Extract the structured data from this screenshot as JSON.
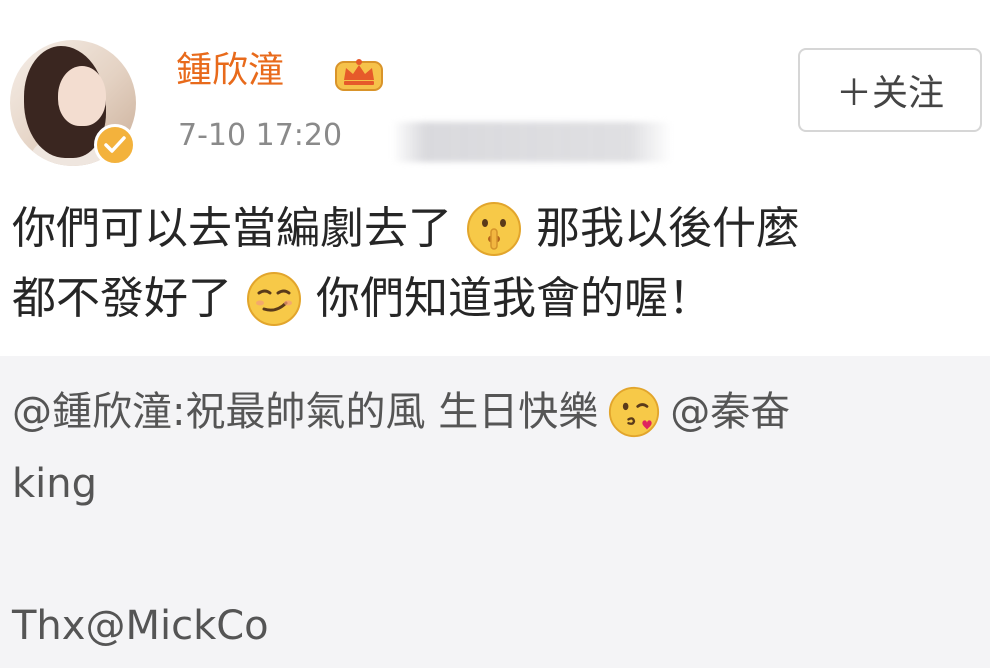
{
  "user": {
    "name": "鍾欣潼",
    "avatar": "avatar",
    "verified_icon": "verified-check-icon",
    "member_icon": "crown-icon",
    "timestamp": "7-10 17:20"
  },
  "follow_button": {
    "label": "＋关注"
  },
  "post": {
    "line1_a": "你們可以去當編劇去了",
    "emoji1": "shushing-face-emoji",
    "line1_b": "那我以後什麼",
    "line2_a": "都不發好了",
    "emoji2": "smirk-emoji",
    "line2_b": "你們知道我會的喔！"
  },
  "repost": {
    "mention": "@鍾欣潼",
    "text": ":祝最帥氣的風 生日快樂",
    "emoji": "face-blowing-kiss-emoji",
    "mention2_part1": "@秦奋",
    "mention2_part2": "king",
    "thanks": "Thx@MickCo"
  },
  "colors": {
    "username": "#e86a1b",
    "timestamp": "#8a8a8a",
    "repost_background": "#f4f4f6",
    "badge": "#f3b23c"
  }
}
